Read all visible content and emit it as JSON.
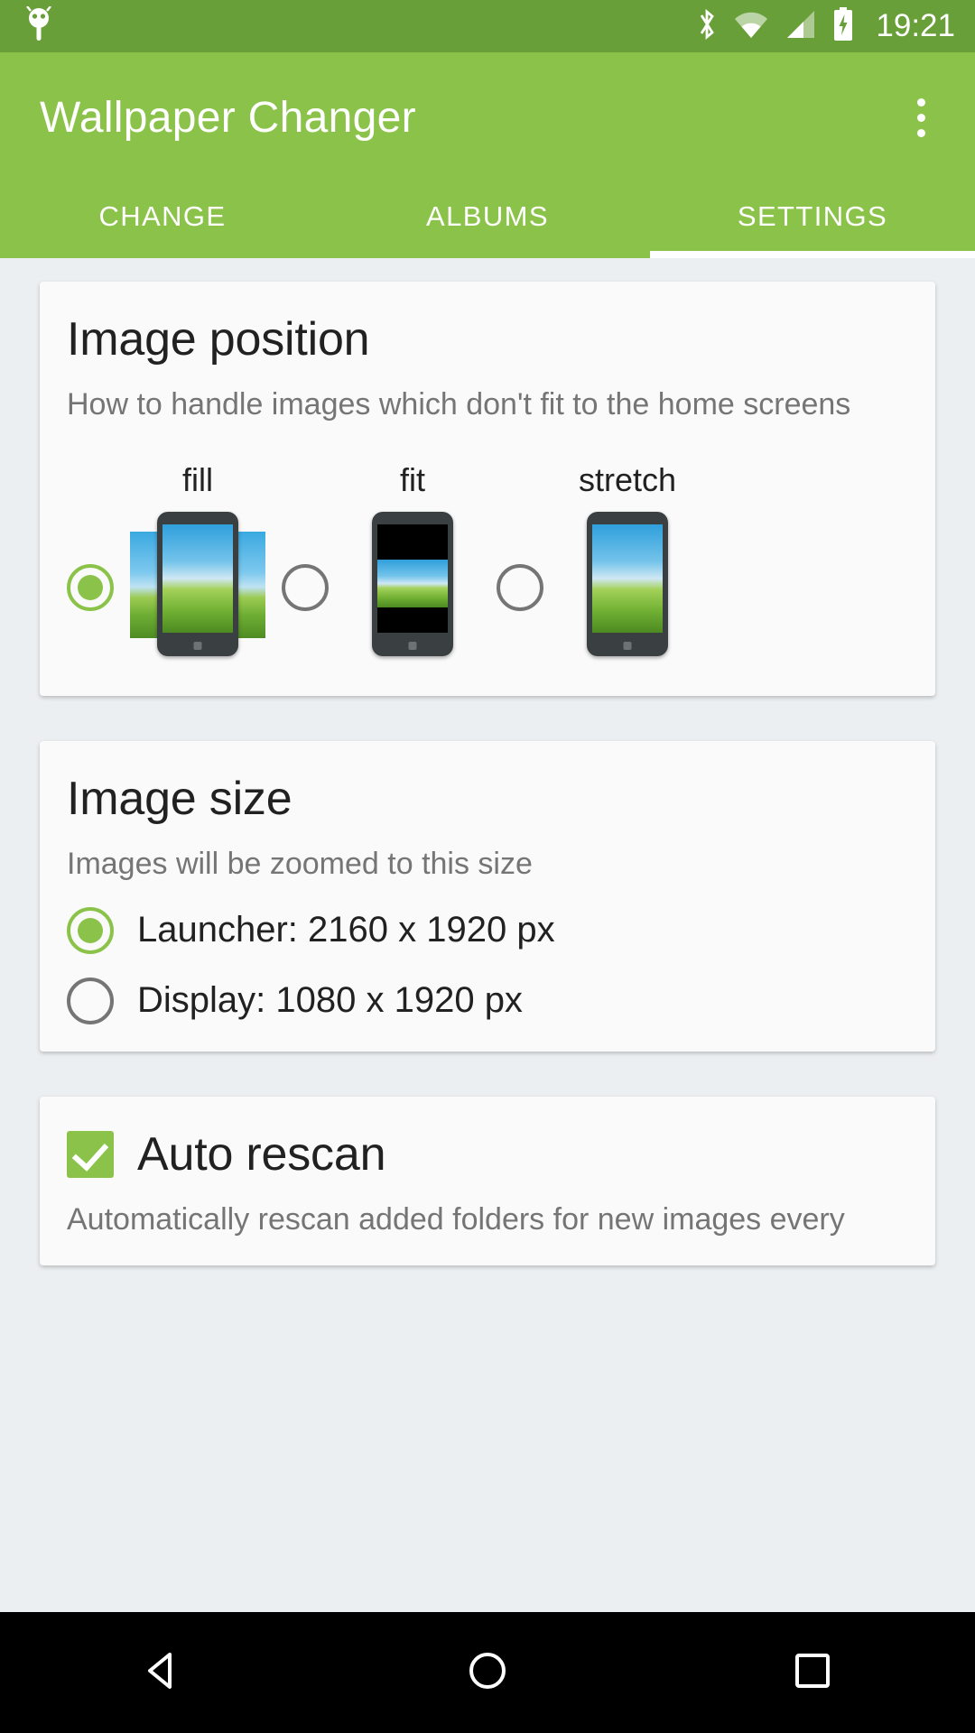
{
  "statusbar": {
    "time": "19:21",
    "icons": [
      "android-bug-icon",
      "bluetooth-icon",
      "wifi-icon",
      "cell-signal-icon",
      "battery-charging-icon"
    ]
  },
  "appbar": {
    "title": "Wallpaper Changer",
    "overflow_label": "more-options"
  },
  "tabs": [
    {
      "label": "CHANGE",
      "active": false
    },
    {
      "label": "ALBUMS",
      "active": false
    },
    {
      "label": "SETTINGS",
      "active": true
    }
  ],
  "cards": {
    "image_position": {
      "title": "Image position",
      "subtitle": "How to handle images which don't fit to the home screens",
      "options": [
        {
          "label": "fill",
          "selected": true
        },
        {
          "label": "fit",
          "selected": false
        },
        {
          "label": "stretch",
          "selected": false
        }
      ]
    },
    "image_size": {
      "title": "Image size",
      "subtitle": "Images will be zoomed to this size",
      "options": [
        {
          "label": "Launcher: 2160 x 1920 px",
          "selected": true
        },
        {
          "label": "Display: 1080 x 1920 px",
          "selected": false
        }
      ]
    },
    "auto_rescan": {
      "title": "Auto rescan",
      "checked": true,
      "subtitle": "Automatically rescan added folders for new images every"
    }
  },
  "navbar": {
    "back": "back-icon",
    "home": "home-icon",
    "recents": "recents-icon"
  },
  "colors": {
    "status_bar": "#689f38",
    "app_bar": "#8bc34a",
    "accent": "#8bc34a",
    "background": "#eceff1",
    "card": "#fafafa"
  }
}
